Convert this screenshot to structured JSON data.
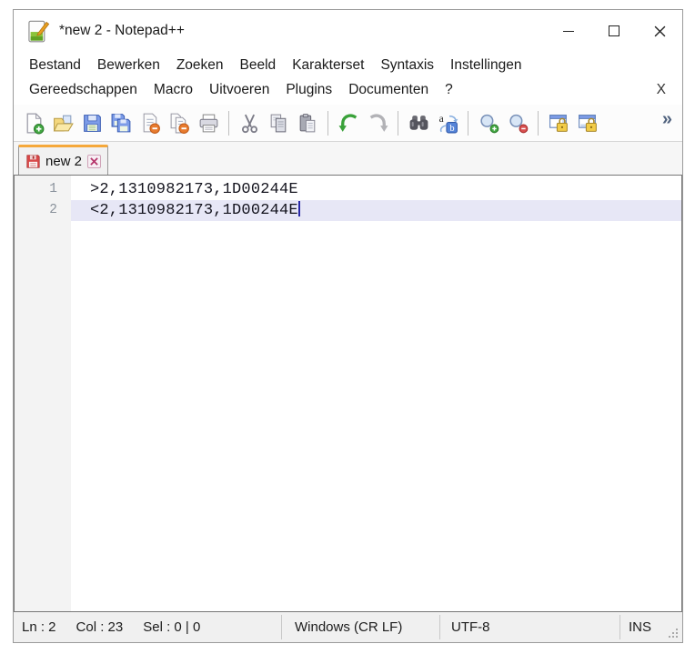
{
  "window": {
    "title": "*new 2 - Notepad++"
  },
  "menubar": {
    "row1": [
      "Bestand",
      "Bewerken",
      "Zoeken",
      "Beeld",
      "Karakterset",
      "Syntaxis",
      "Instellingen"
    ],
    "row2": [
      "Gereedschappen",
      "Macro",
      "Uitvoeren",
      "Plugins",
      "Documenten",
      "?"
    ],
    "close_label": "X"
  },
  "toolbar": {
    "icons": [
      "new-file",
      "open-file",
      "save-file",
      "save-all",
      "close-file",
      "close-all",
      "print",
      "cut",
      "copy",
      "paste",
      "undo",
      "redo",
      "find",
      "replace",
      "zoom-in",
      "zoom-out",
      "sync-vertical-scroll",
      "sync-horizontal-scroll"
    ],
    "overflow_label": "»"
  },
  "tabbar": {
    "tabs": [
      {
        "label": "new 2",
        "modified": true
      }
    ]
  },
  "editor": {
    "lines": [
      {
        "number": "1",
        "text": ">2,1310982173,1D00244E",
        "current": false
      },
      {
        "number": "2",
        "text": "<2,1310982173,1D00244E",
        "current": true
      }
    ]
  },
  "statusbar": {
    "position": {
      "line": "Ln : 2",
      "column": "Col : 23",
      "selection": "Sel : 0 | 0"
    },
    "eol": "Windows (CR LF)",
    "encoding": "UTF-8",
    "mode": "INS"
  },
  "colors": {
    "active_tab_accent": "#f5a83a",
    "unsaved_indicator_red": "#d84848",
    "current_line_highlight": "#e7e7f6",
    "editor_background": "#ffffff",
    "chrome_background": "#f0f0f0"
  }
}
